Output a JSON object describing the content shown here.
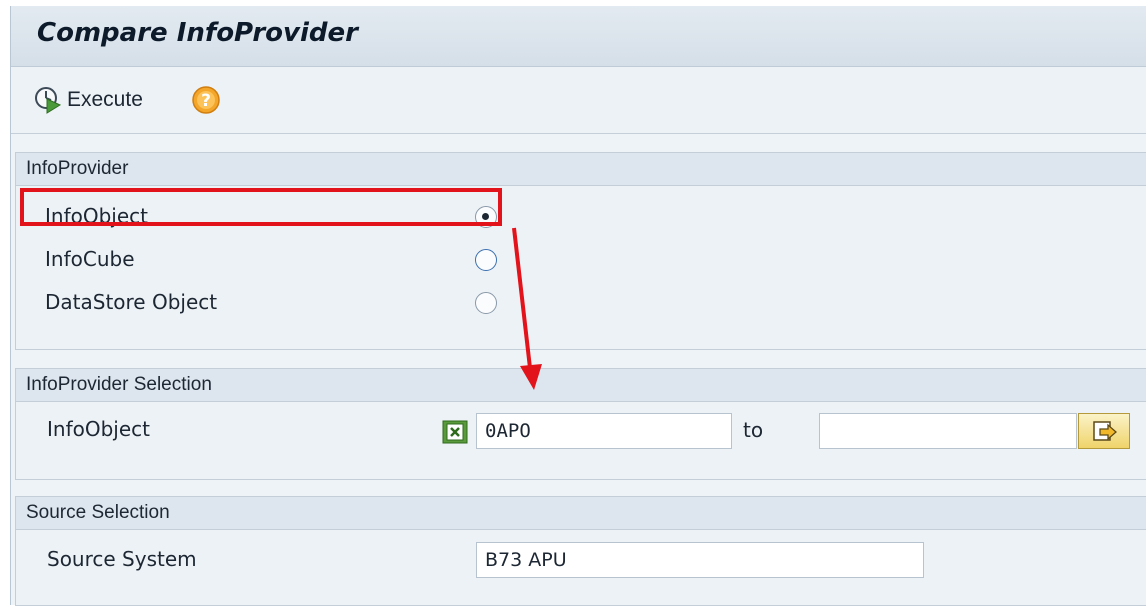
{
  "window": {
    "title": "Compare InfoProvider"
  },
  "toolbar": {
    "execute_label": "Execute",
    "help_icon": "help-icon"
  },
  "infoprovider_group": {
    "title": "InfoProvider",
    "options": [
      {
        "label": "InfoObject",
        "selected": true
      },
      {
        "label": "InfoCube",
        "selected": false
      },
      {
        "label": "DataStore Object",
        "selected": false
      }
    ]
  },
  "selection_group": {
    "title": "InfoProvider Selection",
    "field_label": "InfoObject",
    "from_value": "0APO",
    "to_label": "to",
    "to_value": ""
  },
  "source_group": {
    "title": "Source Selection",
    "field_label": "Source System",
    "value": "B73 APU"
  },
  "annotation": {
    "color": "#e3131b"
  }
}
